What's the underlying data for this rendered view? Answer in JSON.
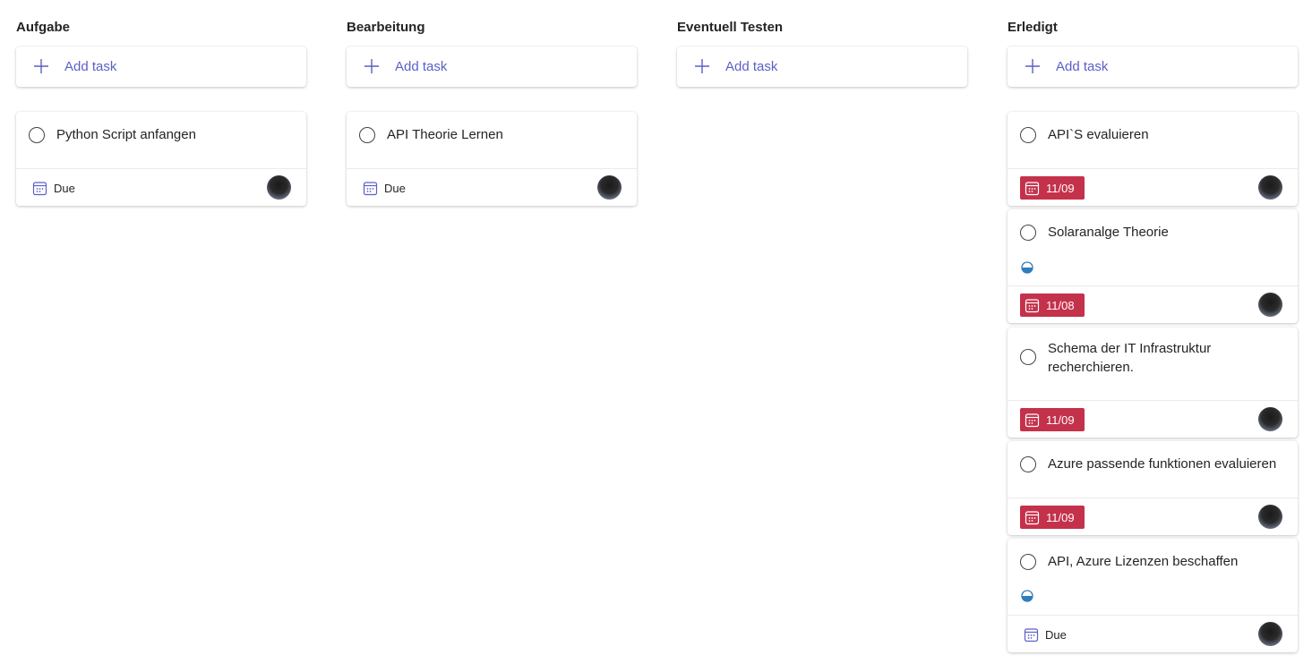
{
  "add_task_label": "Add task",
  "colors": {
    "accent": "#5b5fc7",
    "overdue": "#c4314b",
    "progress": "#2f7cbf"
  },
  "icons": {
    "add": "plus-icon",
    "calendar": "calendar-icon",
    "progress": "half-circle-progress-icon",
    "complete": "circle-checkbox-icon"
  },
  "columns": [
    {
      "title": "Aufgabe",
      "tasks": [
        {
          "title": "Python Script anfangen",
          "due": "Due",
          "overdue": false,
          "in_progress": false
        }
      ]
    },
    {
      "title": "Bearbeitung",
      "tasks": [
        {
          "title": "API Theorie Lernen",
          "due": "Due",
          "overdue": false,
          "in_progress": false
        }
      ]
    },
    {
      "title": "Eventuell Testen",
      "tasks": []
    },
    {
      "title": "Erledigt",
      "tasks": [
        {
          "title": "API`S evaluieren",
          "due": "11/09",
          "overdue": true,
          "in_progress": false
        },
        {
          "title": "Solaranalge Theorie",
          "due": "11/08",
          "overdue": true,
          "in_progress": true
        },
        {
          "title": "Schema der IT Infrastruktur recherchieren.",
          "due": "11/09",
          "overdue": true,
          "in_progress": false
        },
        {
          "title": "Azure passende funktionen evaluieren",
          "due": "11/09",
          "overdue": true,
          "in_progress": false
        },
        {
          "title": "API, Azure Lizenzen beschaffen",
          "due": "Due",
          "overdue": false,
          "in_progress": true
        }
      ]
    }
  ]
}
